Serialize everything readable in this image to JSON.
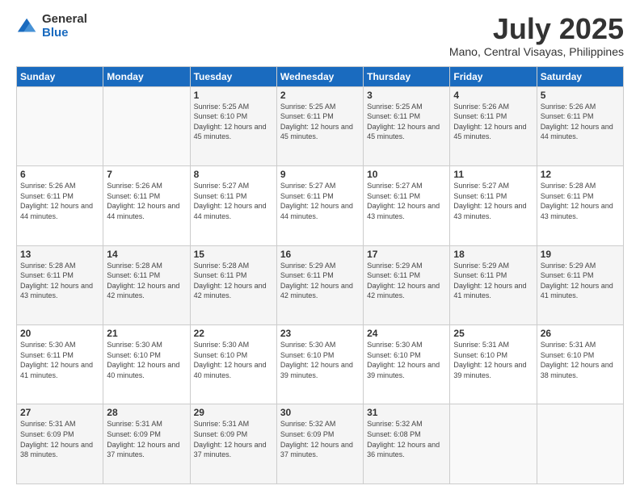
{
  "logo": {
    "general": "General",
    "blue": "Blue"
  },
  "title": "July 2025",
  "subtitle": "Mano, Central Visayas, Philippines",
  "days_of_week": [
    "Sunday",
    "Monday",
    "Tuesday",
    "Wednesday",
    "Thursday",
    "Friday",
    "Saturday"
  ],
  "weeks": [
    [
      {
        "day": "",
        "sunrise": "",
        "sunset": "",
        "daylight": ""
      },
      {
        "day": "",
        "sunrise": "",
        "sunset": "",
        "daylight": ""
      },
      {
        "day": "1",
        "sunrise": "Sunrise: 5:25 AM",
        "sunset": "Sunset: 6:10 PM",
        "daylight": "Daylight: 12 hours and 45 minutes."
      },
      {
        "day": "2",
        "sunrise": "Sunrise: 5:25 AM",
        "sunset": "Sunset: 6:11 PM",
        "daylight": "Daylight: 12 hours and 45 minutes."
      },
      {
        "day": "3",
        "sunrise": "Sunrise: 5:25 AM",
        "sunset": "Sunset: 6:11 PM",
        "daylight": "Daylight: 12 hours and 45 minutes."
      },
      {
        "day": "4",
        "sunrise": "Sunrise: 5:26 AM",
        "sunset": "Sunset: 6:11 PM",
        "daylight": "Daylight: 12 hours and 45 minutes."
      },
      {
        "day": "5",
        "sunrise": "Sunrise: 5:26 AM",
        "sunset": "Sunset: 6:11 PM",
        "daylight": "Daylight: 12 hours and 44 minutes."
      }
    ],
    [
      {
        "day": "6",
        "sunrise": "Sunrise: 5:26 AM",
        "sunset": "Sunset: 6:11 PM",
        "daylight": "Daylight: 12 hours and 44 minutes."
      },
      {
        "day": "7",
        "sunrise": "Sunrise: 5:26 AM",
        "sunset": "Sunset: 6:11 PM",
        "daylight": "Daylight: 12 hours and 44 minutes."
      },
      {
        "day": "8",
        "sunrise": "Sunrise: 5:27 AM",
        "sunset": "Sunset: 6:11 PM",
        "daylight": "Daylight: 12 hours and 44 minutes."
      },
      {
        "day": "9",
        "sunrise": "Sunrise: 5:27 AM",
        "sunset": "Sunset: 6:11 PM",
        "daylight": "Daylight: 12 hours and 44 minutes."
      },
      {
        "day": "10",
        "sunrise": "Sunrise: 5:27 AM",
        "sunset": "Sunset: 6:11 PM",
        "daylight": "Daylight: 12 hours and 43 minutes."
      },
      {
        "day": "11",
        "sunrise": "Sunrise: 5:27 AM",
        "sunset": "Sunset: 6:11 PM",
        "daylight": "Daylight: 12 hours and 43 minutes."
      },
      {
        "day": "12",
        "sunrise": "Sunrise: 5:28 AM",
        "sunset": "Sunset: 6:11 PM",
        "daylight": "Daylight: 12 hours and 43 minutes."
      }
    ],
    [
      {
        "day": "13",
        "sunrise": "Sunrise: 5:28 AM",
        "sunset": "Sunset: 6:11 PM",
        "daylight": "Daylight: 12 hours and 43 minutes."
      },
      {
        "day": "14",
        "sunrise": "Sunrise: 5:28 AM",
        "sunset": "Sunset: 6:11 PM",
        "daylight": "Daylight: 12 hours and 42 minutes."
      },
      {
        "day": "15",
        "sunrise": "Sunrise: 5:28 AM",
        "sunset": "Sunset: 6:11 PM",
        "daylight": "Daylight: 12 hours and 42 minutes."
      },
      {
        "day": "16",
        "sunrise": "Sunrise: 5:29 AM",
        "sunset": "Sunset: 6:11 PM",
        "daylight": "Daylight: 12 hours and 42 minutes."
      },
      {
        "day": "17",
        "sunrise": "Sunrise: 5:29 AM",
        "sunset": "Sunset: 6:11 PM",
        "daylight": "Daylight: 12 hours and 42 minutes."
      },
      {
        "day": "18",
        "sunrise": "Sunrise: 5:29 AM",
        "sunset": "Sunset: 6:11 PM",
        "daylight": "Daylight: 12 hours and 41 minutes."
      },
      {
        "day": "19",
        "sunrise": "Sunrise: 5:29 AM",
        "sunset": "Sunset: 6:11 PM",
        "daylight": "Daylight: 12 hours and 41 minutes."
      }
    ],
    [
      {
        "day": "20",
        "sunrise": "Sunrise: 5:30 AM",
        "sunset": "Sunset: 6:11 PM",
        "daylight": "Daylight: 12 hours and 41 minutes."
      },
      {
        "day": "21",
        "sunrise": "Sunrise: 5:30 AM",
        "sunset": "Sunset: 6:10 PM",
        "daylight": "Daylight: 12 hours and 40 minutes."
      },
      {
        "day": "22",
        "sunrise": "Sunrise: 5:30 AM",
        "sunset": "Sunset: 6:10 PM",
        "daylight": "Daylight: 12 hours and 40 minutes."
      },
      {
        "day": "23",
        "sunrise": "Sunrise: 5:30 AM",
        "sunset": "Sunset: 6:10 PM",
        "daylight": "Daylight: 12 hours and 39 minutes."
      },
      {
        "day": "24",
        "sunrise": "Sunrise: 5:30 AM",
        "sunset": "Sunset: 6:10 PM",
        "daylight": "Daylight: 12 hours and 39 minutes."
      },
      {
        "day": "25",
        "sunrise": "Sunrise: 5:31 AM",
        "sunset": "Sunset: 6:10 PM",
        "daylight": "Daylight: 12 hours and 39 minutes."
      },
      {
        "day": "26",
        "sunrise": "Sunrise: 5:31 AM",
        "sunset": "Sunset: 6:10 PM",
        "daylight": "Daylight: 12 hours and 38 minutes."
      }
    ],
    [
      {
        "day": "27",
        "sunrise": "Sunrise: 5:31 AM",
        "sunset": "Sunset: 6:09 PM",
        "daylight": "Daylight: 12 hours and 38 minutes."
      },
      {
        "day": "28",
        "sunrise": "Sunrise: 5:31 AM",
        "sunset": "Sunset: 6:09 PM",
        "daylight": "Daylight: 12 hours and 37 minutes."
      },
      {
        "day": "29",
        "sunrise": "Sunrise: 5:31 AM",
        "sunset": "Sunset: 6:09 PM",
        "daylight": "Daylight: 12 hours and 37 minutes."
      },
      {
        "day": "30",
        "sunrise": "Sunrise: 5:32 AM",
        "sunset": "Sunset: 6:09 PM",
        "daylight": "Daylight: 12 hours and 37 minutes."
      },
      {
        "day": "31",
        "sunrise": "Sunrise: 5:32 AM",
        "sunset": "Sunset: 6:08 PM",
        "daylight": "Daylight: 12 hours and 36 minutes."
      },
      {
        "day": "",
        "sunrise": "",
        "sunset": "",
        "daylight": ""
      },
      {
        "day": "",
        "sunrise": "",
        "sunset": "",
        "daylight": ""
      }
    ]
  ]
}
